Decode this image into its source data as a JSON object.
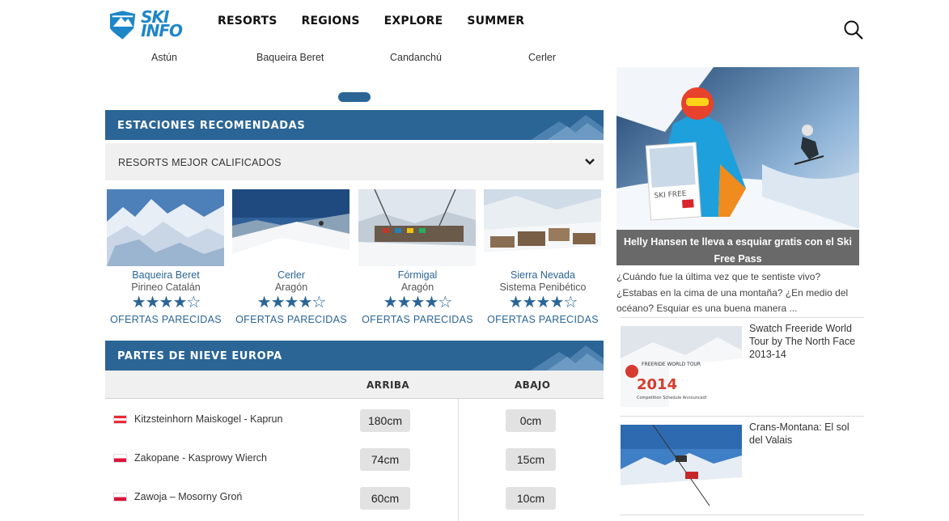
{
  "header": {
    "logo_line1": "SKI",
    "logo_line2": "INFO",
    "nav": [
      "RESORTS",
      "REGIONS",
      "EXPLORE",
      "SUMMER"
    ]
  },
  "slider": {
    "labels": [
      "Astún",
      "Baqueira Beret",
      "Candanchú",
      "Cerler"
    ]
  },
  "recommended": {
    "title": "ESTACIONES RECOMENDADAS",
    "dropdown_value": "RESORTS MEJOR CALIFICADOS",
    "cards": [
      {
        "name": "Baqueira Beret",
        "region": "Pirineo Catalán",
        "rating": 4,
        "max_rating": 5,
        "offers": "OFERTAS PARECIDAS"
      },
      {
        "name": "Cerler",
        "region": "Aragón",
        "rating": 4,
        "max_rating": 5,
        "offers": "OFERTAS PARECIDAS"
      },
      {
        "name": "Fórmigal",
        "region": "Aragón",
        "rating": 4,
        "max_rating": 5,
        "offers": "OFERTAS PARECIDAS"
      },
      {
        "name": "Sierra Nevada",
        "region": "Sistema Penibético",
        "rating": 4,
        "max_rating": 5,
        "offers": "OFERTAS PARECIDAS"
      }
    ]
  },
  "snow_report": {
    "title": "PARTES DE NIEVE EUROPA",
    "col_top": "ARRIBA",
    "col_bottom": "ABAJO",
    "rows": [
      {
        "country": "austria",
        "name": "Kitzsteinhorn Maiskogel - Kaprun",
        "top": "180cm",
        "bottom": "0cm"
      },
      {
        "country": "poland",
        "name": "Zakopane - Kasprowy Wierch",
        "top": "74cm",
        "bottom": "15cm"
      },
      {
        "country": "poland",
        "name": "Zawoja – Mosorny Groń",
        "top": "60cm",
        "bottom": "10cm"
      }
    ]
  },
  "sidebar": {
    "ad_caption": "Helly Hansen te lleva a esquiar gratis con el Ski Free Pass",
    "ad_badge": "SKI FREE",
    "ad_description": "¿Cuándo fue la última vez que te sentiste vivo? ¿Estabas en la cima de una montaña? ¿En medio del océano? Esquiar es una buena manera ...",
    "news": [
      {
        "title": "Swatch Freeride World Tour by The North Face 2013-14",
        "img_text": "2014",
        "img_text_small": "FREERIDE WORLD TOUR",
        "img_sub": "Competition Schedule Announced!"
      },
      {
        "title": "Crans-Montana: El sol del Valais"
      }
    ]
  },
  "colors": {
    "brand_blue": "#2a6596",
    "logo_blue": "#1e86c8",
    "panel_grey": "#f0f0f0"
  }
}
